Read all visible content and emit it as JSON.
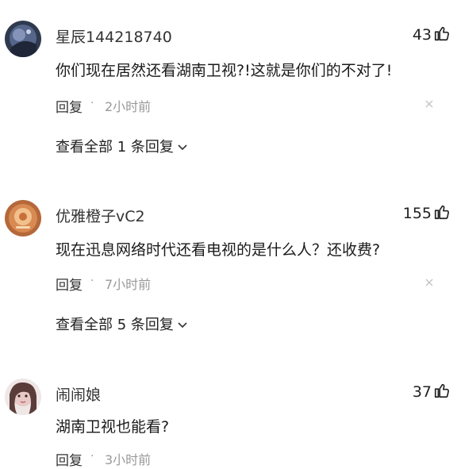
{
  "comments": [
    {
      "username": "星辰144218740",
      "likes": "43",
      "text": "你们现在居然还看湖南卫视?!这就是你们的不对了!",
      "reply_label": "回复",
      "separator": "·",
      "time": "2小时前",
      "view_replies": "查看全部 1 条回复"
    },
    {
      "username": "优雅橙子vC2",
      "likes": "155",
      "text": "现在迅息网络时代还看电视的是什么人？还收费?",
      "reply_label": "回复",
      "separator": "·",
      "time": "7小时前",
      "view_replies": "查看全部 5 条回复"
    },
    {
      "username": "闹闹娘",
      "likes": "37",
      "text": "湖南卫视也能看?",
      "reply_label": "回复",
      "separator": "·",
      "time": "3小时前"
    }
  ],
  "icons": {
    "like": "thumbs-up-icon",
    "close": "close-icon",
    "expand": "chevron-down-icon"
  },
  "colors": {
    "text": "#222222",
    "muted": "#999999",
    "background": "#ffffff"
  }
}
